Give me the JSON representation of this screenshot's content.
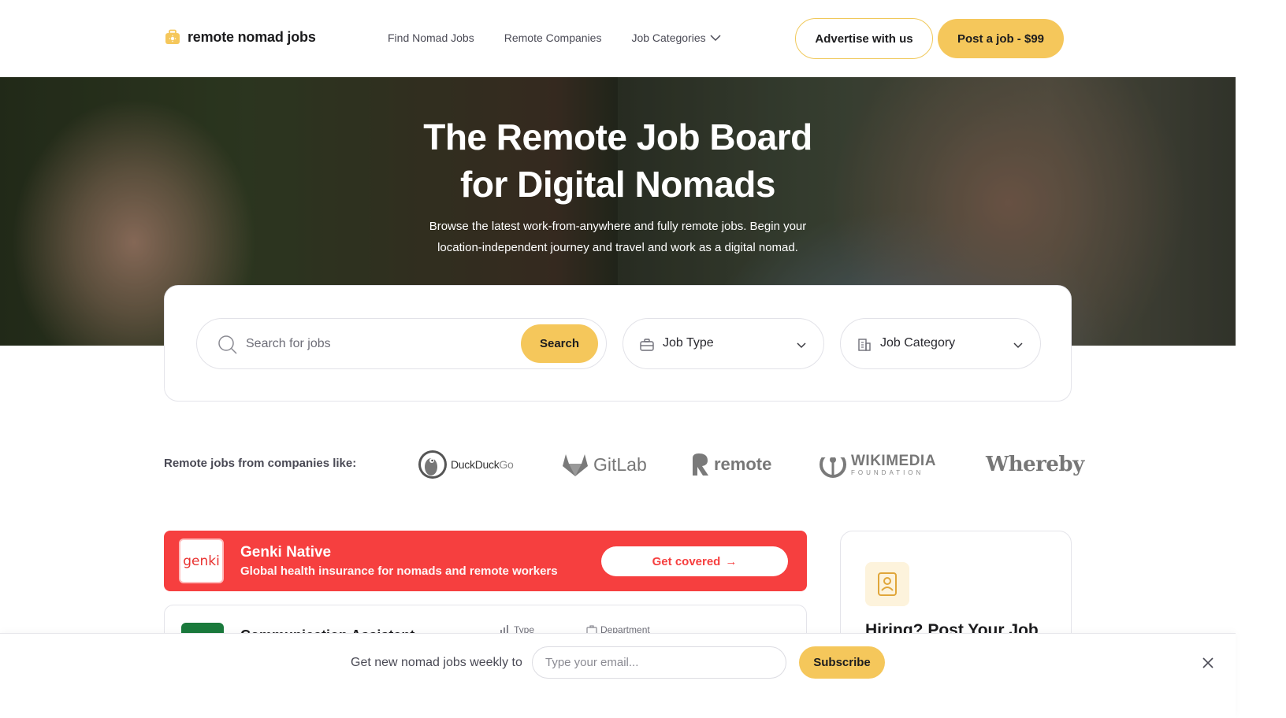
{
  "header": {
    "logo_text": "remote nomad jobs",
    "nav": [
      {
        "label": "Find Nomad Jobs"
      },
      {
        "label": "Remote Companies"
      },
      {
        "label": "Job Categories"
      }
    ],
    "advertise_label": "Advertise with us",
    "post_job_label": "Post a job - $99"
  },
  "hero": {
    "title_line1": "The Remote Job Board",
    "title_line2": "for Digital Nomads",
    "subtitle_line1": "Browse the latest work-from-anywhere and fully remote jobs. Begin your",
    "subtitle_line2": "location-independent journey and travel and work as a digital nomad."
  },
  "search": {
    "placeholder": "Search for jobs",
    "button_label": "Search",
    "job_type_label": "Job Type",
    "job_category_label": "Job Category"
  },
  "companies": {
    "label": "Remote jobs from companies like:",
    "items": [
      {
        "name": "DuckDuckGo",
        "part1": "DuckDuck",
        "part2": "Go"
      },
      {
        "name": "GitLab"
      },
      {
        "name": "remote"
      },
      {
        "name": "WIKIMEDIA",
        "sub": "FOUNDATION"
      },
      {
        "name": "Whereby"
      }
    ]
  },
  "promo": {
    "logo_text": "genki",
    "title": "Genki Native",
    "subtitle": "Global health insurance for nomads and remote workers",
    "button_label": "Get covered",
    "button_arrow": "→"
  },
  "job": {
    "title": "Communication Assistant",
    "type_label": "Type",
    "department_label": "Department"
  },
  "side": {
    "title": "Hiring? Post Your Job"
  },
  "newsletter": {
    "label": "Get new nomad jobs weekly to",
    "placeholder": "Type your email...",
    "button_label": "Subscribe"
  },
  "colors": {
    "accent": "#f5c75b",
    "promo": "#f63f3f",
    "text": "#1c1c1e"
  }
}
